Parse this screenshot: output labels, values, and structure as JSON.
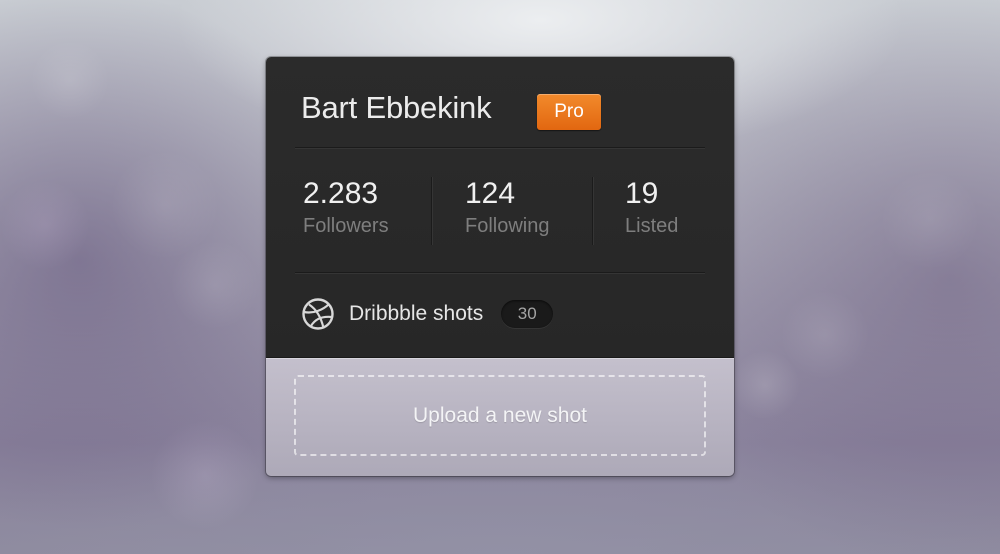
{
  "profile": {
    "name": "Bart Ebbekink",
    "badge": "Pro"
  },
  "stats": [
    {
      "value": "2.283",
      "label": "Followers"
    },
    {
      "value": "124",
      "label": "Following"
    },
    {
      "value": "19",
      "label": "Listed"
    }
  ],
  "shots": {
    "icon": "dribbble-icon",
    "label": "Dribbble shots",
    "count": "30"
  },
  "upload": {
    "label": "Upload a new shot"
  },
  "colors": {
    "card_background": "#282828",
    "badge_orange": "#ee7a1e",
    "stat_label_gray": "#7e7e7e",
    "upload_panel": "#bbb7c5"
  }
}
